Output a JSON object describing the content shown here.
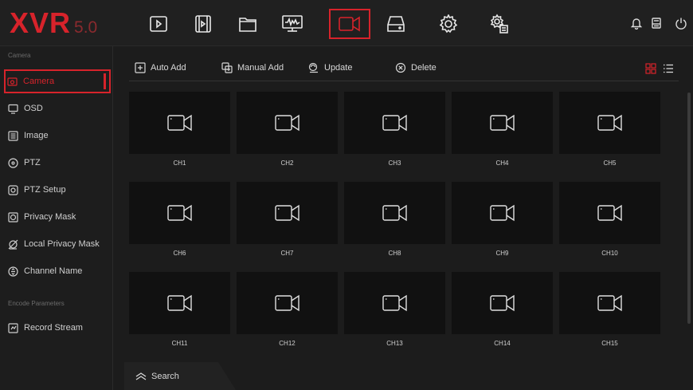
{
  "logo": {
    "brand": "XVR",
    "version": "5.0"
  },
  "nav": {
    "icons": [
      "play-icon",
      "film-icon",
      "folder-icon",
      "monitor-waveform-icon",
      "camera-icon",
      "hdd-icon",
      "gear-icon",
      "settings-cog-icon"
    ],
    "active": "camera-icon"
  },
  "topright": [
    "bell-icon",
    "printer-icon",
    "power-icon"
  ],
  "sidebar": {
    "section_camera": "Camera",
    "section_encode": "Encode Parameters",
    "items": [
      {
        "label": "Camera",
        "icon": "camera-small-icon",
        "active": true
      },
      {
        "label": "OSD",
        "icon": "monitor-icon"
      },
      {
        "label": "Image",
        "icon": "image-settings-icon"
      },
      {
        "label": "PTZ",
        "icon": "ptz-icon"
      },
      {
        "label": "PTZ Setup",
        "icon": "ptz-setup-icon"
      },
      {
        "label": "Privacy Mask",
        "icon": "privacy-mask-icon"
      },
      {
        "label": "Local Privacy Mask",
        "icon": "local-privacy-mask-icon"
      },
      {
        "label": "Channel Name",
        "icon": "channel-name-icon"
      },
      {
        "label": "Record Stream",
        "icon": "record-stream-icon"
      }
    ]
  },
  "toolbar": {
    "auto_add": "Auto Add",
    "manual_add": "Manual Add",
    "update": "Update",
    "delete": "Delete",
    "view_modes": [
      "grid-view-icon",
      "list-view-icon"
    ],
    "active_view": "grid-view-icon"
  },
  "channels": [
    "CH1",
    "CH2",
    "CH3",
    "CH4",
    "CH5",
    "CH6",
    "CH7",
    "CH8",
    "CH9",
    "CH10",
    "CH11",
    "CH12",
    "CH13",
    "CH14",
    "CH15"
  ],
  "search": {
    "label": "Search"
  },
  "colors": {
    "accent": "#d7232b",
    "background": "#1c1c1c",
    "tile": "#111111"
  }
}
